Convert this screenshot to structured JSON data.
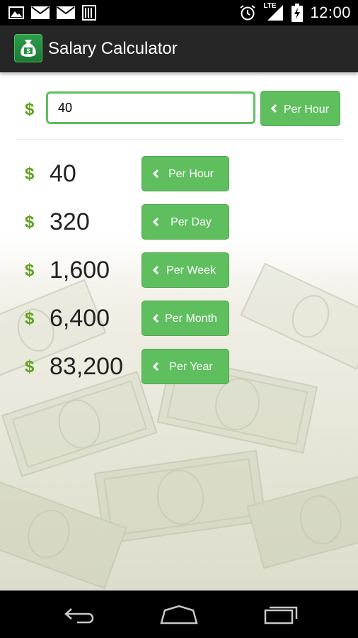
{
  "status_bar": {
    "time": "12:00",
    "network_label": "LTE",
    "left_icons": [
      "image-icon",
      "mail-icon",
      "mail-icon",
      "sim-icon"
    ],
    "right_icons": [
      "alarm-icon",
      "lte-signal-icon",
      "battery-charging-icon"
    ]
  },
  "action_bar": {
    "title": "Salary Calculator",
    "icon": "money-bag-icon"
  },
  "input": {
    "currency_symbol": "$",
    "value": "40",
    "unit_button_label": "Per Hour"
  },
  "results": [
    {
      "currency_symbol": "$",
      "value": "40",
      "button_label": "Per Hour"
    },
    {
      "currency_symbol": "$",
      "value": "320",
      "button_label": "Per Day"
    },
    {
      "currency_symbol": "$",
      "value": "1,600",
      "button_label": "Per Week"
    },
    {
      "currency_symbol": "$",
      "value": "6,400",
      "button_label": "Per Month"
    },
    {
      "currency_symbol": "$",
      "value": "83,200",
      "button_label": "Per Year"
    }
  ],
  "nav_bar": {
    "buttons": [
      "back-icon",
      "home-icon",
      "recent-apps-icon"
    ]
  },
  "colors": {
    "accent_green": "#5fbf5f",
    "dollar_green": "#5ea31e",
    "action_bar": "#262626",
    "status_bar": "#000000"
  }
}
